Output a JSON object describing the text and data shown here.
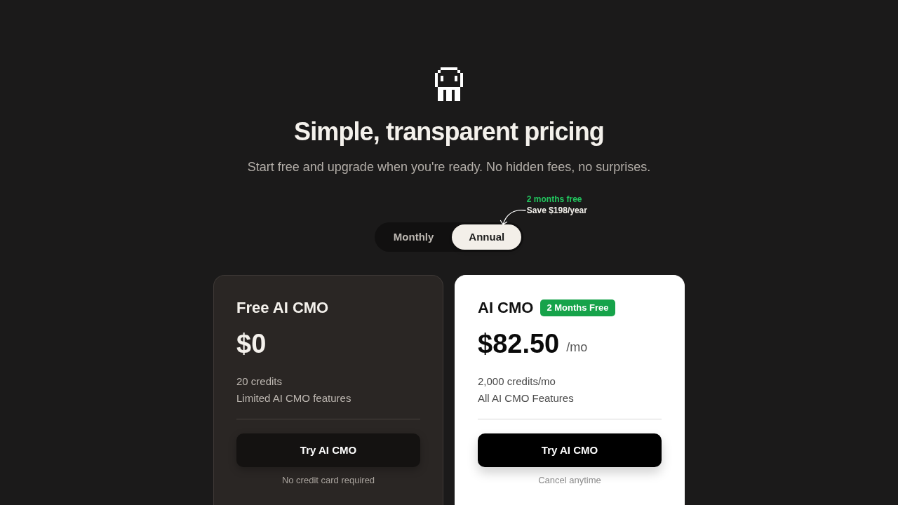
{
  "header": {
    "title": "Simple, transparent pricing",
    "subtitle": "Start free and upgrade when you're ready. No hidden fees, no surprises."
  },
  "billing_toggle": {
    "options": [
      {
        "label": "Monthly",
        "selected": false
      },
      {
        "label": "Annual",
        "selected": true
      }
    ],
    "callout": {
      "highlight": "2 months free",
      "savings": "Save $198/year"
    }
  },
  "plans": [
    {
      "name": "Free AI CMO",
      "featured": false,
      "price": "$0",
      "features": [
        "20 credits",
        "Limited AI CMO features"
      ],
      "button": "Try AI CMO",
      "note": "No credit card required"
    },
    {
      "name": "AI CMO",
      "featured": true,
      "badge": "2 Months Free",
      "price": "$82.50",
      "period": "/mo",
      "features": [
        "2,000 credits/mo",
        "All AI CMO Features"
      ],
      "button": "Try AI CMO",
      "note": "Cancel anytime"
    }
  ]
}
